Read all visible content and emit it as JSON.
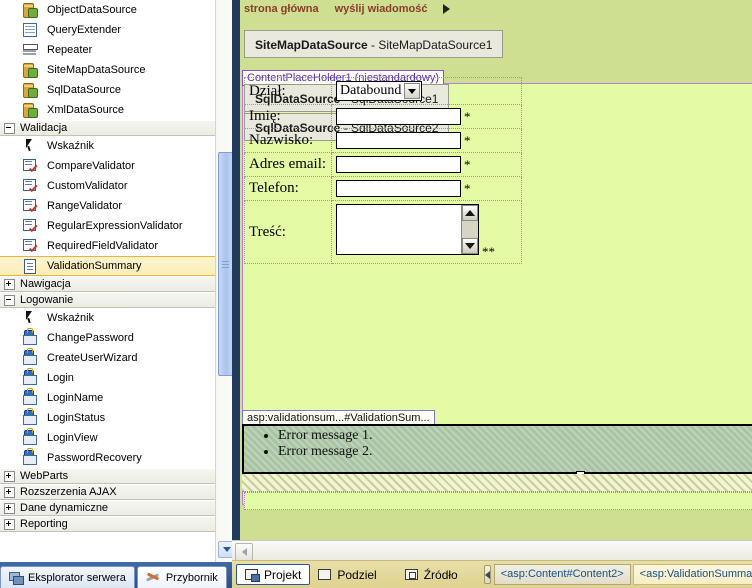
{
  "toolbox": {
    "groups": [
      {
        "items": [
          {
            "label": "ObjectDataSource",
            "icon": "object-datasource-icon",
            "type": "cyl"
          },
          {
            "label": "QueryExtender",
            "icon": "query-extender-icon",
            "type": "grid"
          },
          {
            "label": "Repeater",
            "icon": "repeater-icon",
            "type": "repeater"
          },
          {
            "label": "SiteMapDataSource",
            "icon": "sitemap-datasource-icon",
            "type": "cyl"
          },
          {
            "label": "SqlDataSource",
            "icon": "sql-datasource-icon",
            "type": "cyl"
          },
          {
            "label": "XmlDataSource",
            "icon": "xml-datasource-icon",
            "type": "cyl"
          }
        ]
      },
      {
        "header": "Walidacja",
        "expanded": true,
        "items": [
          {
            "label": "Wskaźnik",
            "icon": "pointer-icon",
            "type": "pointer"
          },
          {
            "label": "CompareValidator",
            "icon": "compare-validator-icon",
            "type": "validator"
          },
          {
            "label": "CustomValidator",
            "icon": "custom-validator-icon",
            "type": "validator"
          },
          {
            "label": "RangeValidator",
            "icon": "range-validator-icon",
            "type": "validator"
          },
          {
            "label": "RegularExpressionValidator",
            "icon": "regex-validator-icon",
            "type": "validator"
          },
          {
            "label": "RequiredFieldValidator",
            "icon": "required-field-validator-icon",
            "type": "validator"
          },
          {
            "label": "ValidationSummary",
            "icon": "validation-summary-icon",
            "type": "note",
            "selected": true
          }
        ]
      },
      {
        "header": "Nawigacja",
        "expanded": false,
        "items": []
      },
      {
        "header": "Logowanie",
        "expanded": true,
        "items": [
          {
            "label": "Wskaźnik",
            "icon": "pointer-icon",
            "type": "pointer"
          },
          {
            "label": "ChangePassword",
            "icon": "change-password-icon",
            "type": "lock"
          },
          {
            "label": "CreateUserWizard",
            "icon": "create-user-wizard-icon",
            "type": "lock"
          },
          {
            "label": "Login",
            "icon": "login-icon",
            "type": "lock"
          },
          {
            "label": "LoginName",
            "icon": "login-name-icon",
            "type": "lock"
          },
          {
            "label": "LoginStatus",
            "icon": "login-status-icon",
            "type": "lock"
          },
          {
            "label": "LoginView",
            "icon": "login-view-icon",
            "type": "lock"
          },
          {
            "label": "PasswordRecovery",
            "icon": "password-recovery-icon",
            "type": "lock"
          }
        ]
      },
      {
        "header": "WebParts",
        "expanded": false,
        "items": []
      },
      {
        "header": "Rozszerzenia AJAX",
        "expanded": false,
        "items": []
      },
      {
        "header": "Dane dynamiczne",
        "expanded": false,
        "items": []
      },
      {
        "header": "Reporting",
        "expanded": false,
        "items": []
      }
    ]
  },
  "dock_tabs": [
    {
      "label": "Eksplorator serwera",
      "icon": "server-explorer-icon",
      "active": false
    },
    {
      "label": "Przybornik",
      "icon": "toolbox-icon",
      "active": true
    }
  ],
  "designer": {
    "nav_links": [
      "strona główna",
      "wyślij wiadomość"
    ],
    "sitemap_datasource": {
      "type": "SiteMapDataSource",
      "id": "SiteMapDataSource1"
    },
    "content_placeholder_tag": "ContentPlaceHolder1 (niestandardowy)",
    "datasources": [
      {
        "type": "SqlDataSource",
        "id": "SqlDataSource1"
      },
      {
        "type": "SqlDataSource",
        "id": "SqlDataSource2"
      }
    ],
    "form_rows": [
      {
        "label": "Dział:",
        "control": "dropdown",
        "value": "Databound",
        "required": ""
      },
      {
        "label": "Imię:",
        "control": "textbox",
        "value": "",
        "required": "*"
      },
      {
        "label": "Nazwisko:",
        "control": "textbox",
        "value": "",
        "required": "*"
      },
      {
        "label": "Adres email:",
        "control": "textbox",
        "value": "",
        "required": "*"
      },
      {
        "label": "Telefon:",
        "control": "textbox",
        "value": "",
        "required": "*"
      },
      {
        "label": "Treść:",
        "control": "textarea",
        "value": "",
        "required": "**"
      }
    ],
    "validation_summary": {
      "tag": "asp:validationsum...#ValidationSum...",
      "messages": [
        "Error message 1.",
        "Error message 2."
      ]
    }
  },
  "viewbar": {
    "buttons": [
      {
        "label": "Projekt",
        "icon": "design-view-icon",
        "active": true
      },
      {
        "label": "Podziel",
        "icon": "split-view-icon",
        "active": false
      },
      {
        "label": "Źródło",
        "icon": "source-view-icon",
        "active": false
      }
    ],
    "breadcrumbs": [
      {
        "label": "<asp:Content#Content2>",
        "current": false
      },
      {
        "label": "<asp:ValidationSummary#",
        "current": true
      }
    ]
  },
  "colors": {
    "designer_outer": "#cedf92",
    "designer_inner": "#e4fba6",
    "placeholder_border": "#c07ae0",
    "validation_summary_bg": "#a8c4a3",
    "nav_link": "#8a3b2c",
    "selected_item": "#fbedb8",
    "viewbar_bg": "#dfd290"
  }
}
